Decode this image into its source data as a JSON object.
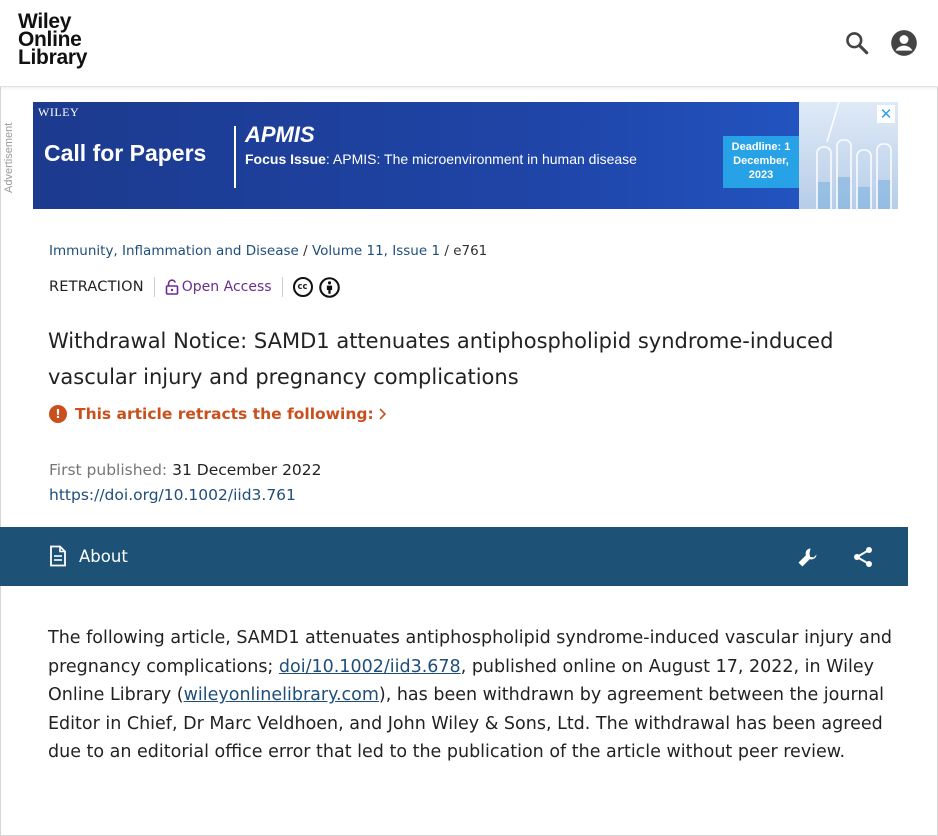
{
  "header": {
    "logo": [
      "Wiley",
      "Online",
      "Library"
    ],
    "search_icon": "search-icon",
    "account_icon": "account-icon"
  },
  "ad": {
    "side_label": "Advertisement",
    "brand": "WILEY",
    "headline": "Call for Papers",
    "journal": "APMIS",
    "focus_label": "Focus Issue",
    "focus_text": ": APMIS: The microenvironment in human disease",
    "deadline": "Deadline: 1 December, 2023",
    "close": "✕"
  },
  "article": {
    "breadcrumb": {
      "journal": "Immunity, Inflammation and Disease",
      "volume": "Volume 11, Issue 1",
      "article_id": "e761"
    },
    "type": "RETRACTION",
    "access": "Open Access",
    "title": "Withdrawal Notice: SAMD1 attenuates antiphospholipid syndrome-induced vascular injury and pregnancy complications",
    "retracts_label": "This article retracts the following:",
    "first_published_label": "First published:",
    "first_published_date": "31 December 2022",
    "doi": "https://doi.org/10.1002/iid3.761"
  },
  "toolbar": {
    "about_label": "About"
  },
  "body": {
    "p1": "The following article, SAMD1 attenuates antiphospholipid syndrome-induced vascular injury and pregnancy complications; ",
    "link1": "doi/10.1002/iid3.678",
    "p2": ", published online on August 17, 2022, in Wiley Online Library (",
    "link2": "wileyonlinelibrary.com",
    "p3": "), has been withdrawn by agreement between the journal Editor in Chief, Dr Marc Veldhoen, and John Wiley & Sons, Ltd. The withdrawal has been agreed due to an editorial office error that led to the publication of the article without peer review."
  },
  "colors": {
    "link": "#1f4e7a",
    "toolbar": "#1d5276",
    "warning": "#c9501c",
    "open_access": "#6b2c8f"
  }
}
